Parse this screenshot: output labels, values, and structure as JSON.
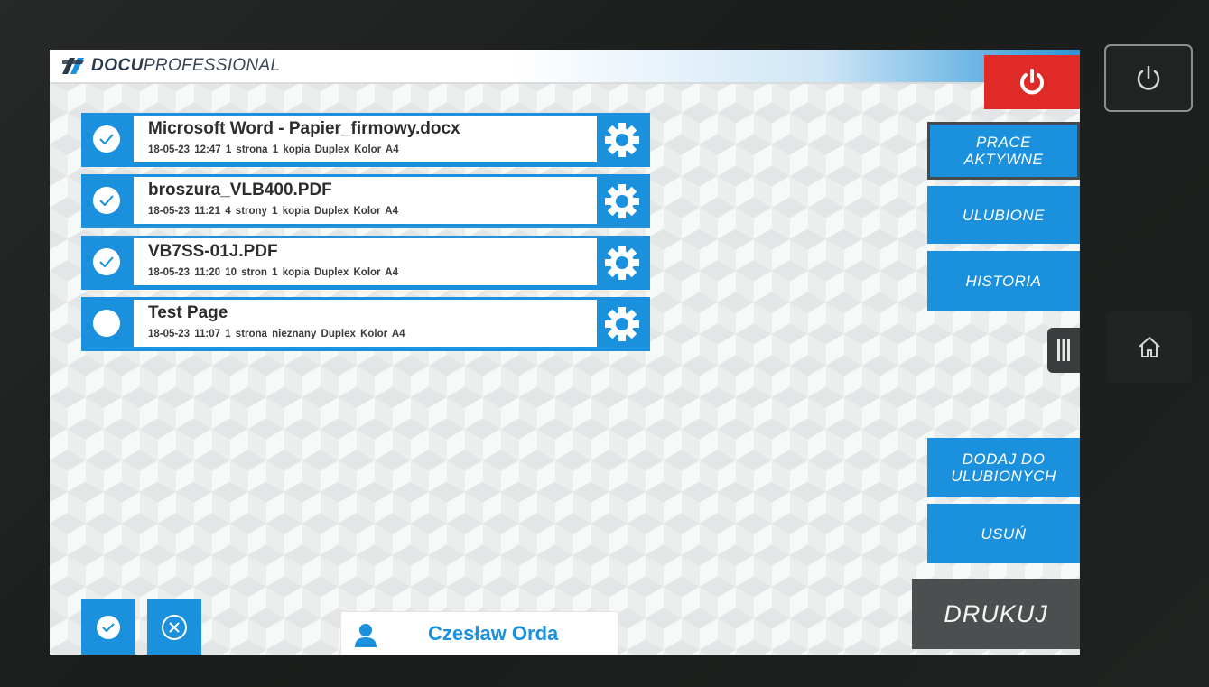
{
  "app": {
    "logo_docu": "DOCU",
    "logo_pro": "PROFESSIONAL"
  },
  "jobs": [
    {
      "title": "Microsoft Word - Papier_firmowy.docx",
      "meta": "18-05-23 12:47  1 strona  1 kopia  Duplex  Kolor  A4",
      "selected": true
    },
    {
      "title": "broszura_VLB400.PDF",
      "meta": "18-05-23 11:21  4 strony  1 kopia  Duplex  Kolor  A4",
      "selected": true
    },
    {
      "title": "VB7SS-01J.PDF",
      "meta": "18-05-23 11:20  10 stron  1 kopia  Duplex  Kolor  A4",
      "selected": true
    },
    {
      "title": "Test Page",
      "meta": "18-05-23 11:07  1 strona  nieznany  Duplex  Kolor  A4",
      "selected": false
    }
  ],
  "sidebar": {
    "active_jobs": "PRACE\nAKTYWNE",
    "favorites": "ULUBIONE",
    "history": "HISTORIA",
    "add_favorites": "DODAJ DO\nULUBIONYCH",
    "delete": "USUŃ",
    "print": "DRUKUJ"
  },
  "user": {
    "name": "Czesław Orda"
  },
  "colors": {
    "accent": "#1b90dc",
    "power": "#e02a27",
    "print_button": "#4b4f50"
  },
  "icons": {
    "job_settings": "gear-icon",
    "job_select": "check-icon",
    "select_all": "check-circle-icon",
    "deselect_all": "x-circle-icon",
    "user": "user-icon",
    "power": "power-icon",
    "home": "home-icon",
    "handle": "drag-handle-icon"
  }
}
